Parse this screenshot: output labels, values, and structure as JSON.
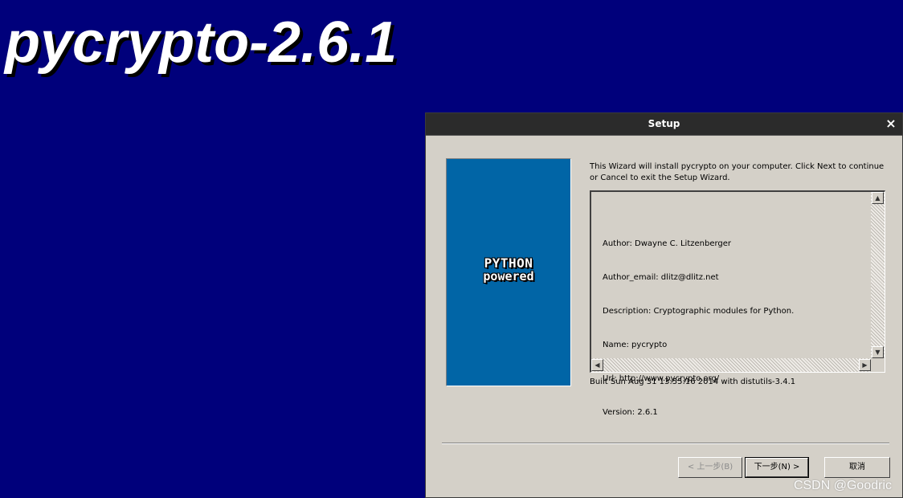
{
  "background": {
    "title": "pycrypto-2.6.1",
    "color": "#00007b"
  },
  "window": {
    "title": "Setup",
    "close_glyph": "×",
    "side_image": {
      "line1": "PYTHON",
      "line2": "powered",
      "color": "#0165a6"
    },
    "intro": "This Wizard will install pycrypto on your computer. Click Next to continue or Cancel to exit the Setup Wizard.",
    "info_lines": [
      "Author: Dwayne C. Litzenberger",
      "Author_email: dlitz@dlitz.net",
      "Description: Cryptographic modules for Python.",
      "Name: pycrypto",
      "Url: http://www.pycrypto.org/",
      "Version: 2.6.1"
    ],
    "built": "Built Sun Aug 31 13:55:16 2014 with distutils-3.4.1",
    "buttons": {
      "back": "< 上一步(B)",
      "next": "下一步(N) >",
      "cancel": "取消"
    }
  },
  "watermark": "CSDN @Goodric"
}
